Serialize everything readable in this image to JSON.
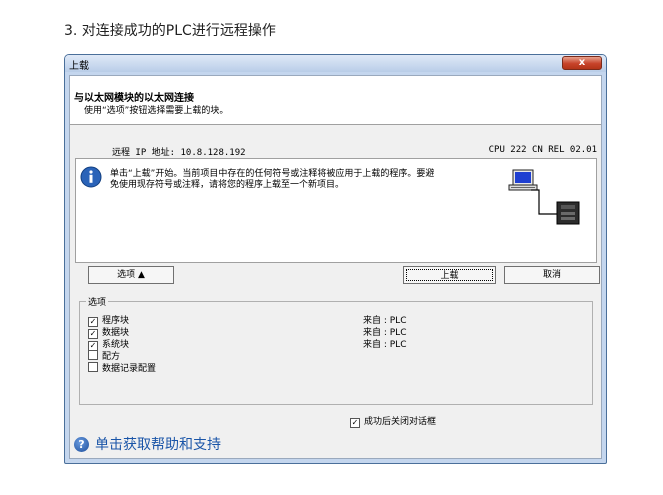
{
  "doc": {
    "heading": "3. 对连接成功的PLC进行远程操作"
  },
  "window": {
    "title": "上载",
    "close_glyph": "x"
  },
  "header": {
    "title": "与以太网模块的以太网连接",
    "subtitle": "使用“选项”按钮选择需要上载的块。"
  },
  "connection": {
    "remote_ip_label": "远程 IP 地址:",
    "remote_ip": "10.8.128.192",
    "cpu": "CPU 222 CN REL 02.01"
  },
  "info": {
    "line1": "单击“上载”开始。当前项目中存在的任何符号或注释将被应用于上载的程序。要避",
    "line2": "免使用现存符号或注释，请将您的程序上载至一个新项目。"
  },
  "buttons": {
    "options": "选项 ▲",
    "upload": "上载",
    "cancel": "取消"
  },
  "options": {
    "legend": "选项",
    "items": [
      {
        "label": "程序块",
        "checked": true,
        "source": "来自 : PLC"
      },
      {
        "label": "数据块",
        "checked": true,
        "source": "来自 : PLC"
      },
      {
        "label": "系统块",
        "checked": true,
        "source": "来自 : PLC"
      },
      {
        "label": "配方",
        "checked": false,
        "source": ""
      },
      {
        "label": "数据记录配置",
        "checked": false,
        "source": ""
      }
    ]
  },
  "close_after": {
    "label": "成功后关闭对话框",
    "checked": true
  },
  "help": {
    "label": "单击获取帮助和支持"
  },
  "check_glyph": "✓"
}
